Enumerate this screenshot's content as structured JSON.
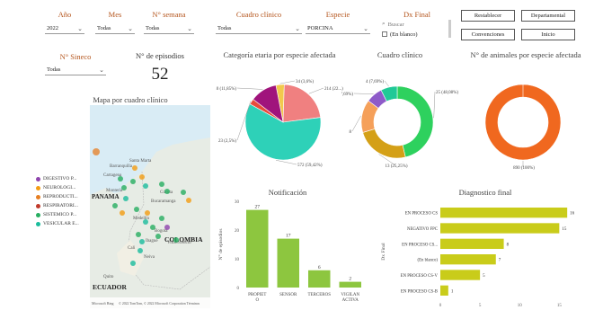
{
  "filters": {
    "ano": {
      "label": "Año",
      "value": "2022"
    },
    "mes": {
      "label": "Mes",
      "value": "Todas"
    },
    "semana": {
      "label": "N° semana",
      "value": "Todas"
    },
    "cuadro": {
      "label": "Cuadro clínico",
      "value": "Todas"
    },
    "especie": {
      "label": "Especie",
      "value": "PORCINA"
    },
    "dx": {
      "label": "Dx Final",
      "search_placeholder": "Buscar",
      "option": "(En blanco)"
    },
    "sineco": {
      "label": "N° Sineco",
      "value": "Todas"
    }
  },
  "buttons": {
    "restablecer": "Restablecer",
    "departamental": "Departamental",
    "convenciones": "Convenciones",
    "inicio": "Inicio"
  },
  "kpi": {
    "label": "N° de episodios",
    "value": "52"
  },
  "map": {
    "title": "Mapa por cuadro clínico",
    "legend": [
      {
        "label": "DIGESTIVO P...",
        "color": "#8e44ad"
      },
      {
        "label": "NEUROLOGI...",
        "color": "#f39c12"
      },
      {
        "label": "REPRODUCTI...",
        "color": "#e67e22"
      },
      {
        "label": "RESPIRATORI...",
        "color": "#c0392b"
      },
      {
        "label": "SISTEMICO P...",
        "color": "#27ae60"
      },
      {
        "label": "VESICULAR E...",
        "color": "#1abc9c"
      }
    ],
    "places": {
      "panama": "PANAMA",
      "colombia": "COLOMBIA",
      "ecuador": "ECUADOR",
      "santa_marta": "Santa Marta",
      "barranquilla": "Barranquilla",
      "cartagena": "Cartagena",
      "monteria": "Montería",
      "medellin": "Medellín",
      "bogota": "Bogotá",
      "cali": "Cali",
      "quito": "Quito",
      "ibague": "Ibagué",
      "villavicencio": "Villavicencio",
      "neiva": "Neiva",
      "cucuta": "Cúcuta",
      "bucaramanga": "Bucaramanga"
    },
    "attribution": "© 2022 TomTom, © 2022 Microsoft Corporation  Términos",
    "bing": "Microsoft Bing"
  },
  "chart_data": [
    {
      "type": "pie",
      "title": "Categoría etaria por especie afectada",
      "slices": [
        {
          "label": "34 (3,6%)",
          "value": 34,
          "color": "#f2c94c"
        },
        {
          "label": "214 (22...)",
          "value": 214,
          "color": "#f08080"
        },
        {
          "label": "572 (59,42%)",
          "value": 572,
          "color": "#2ed1b8"
        },
        {
          "label": "23 (2,5%)",
          "value": 23,
          "color": "#e74c3c"
        },
        {
          "label": "110 (11,85%)",
          "value": 110,
          "color": "#a0147c"
        }
      ]
    },
    {
      "type": "donut",
      "title": "Cuadro clínico",
      "slices": [
        {
          "label": "25 (48,08%)",
          "value": 25,
          "color": "#2ed15e"
        },
        {
          "label": "13 (25,25%)",
          "value": 13,
          "color": "#d4a017"
        },
        {
          "label": "8",
          "value": 8,
          "color": "#f5a05a"
        },
        {
          "label": "4 (7,69%)",
          "value": 4,
          "color": "#8e5bc9"
        },
        {
          "label": "4 (7,69%)",
          "value": 4,
          "color": "#20c997"
        }
      ]
    },
    {
      "type": "donut",
      "title": "N° de animales por especie afectada",
      "slices": [
        {
          "label": "890 (100%)",
          "value": 890,
          "color": "#f0681f"
        }
      ]
    },
    {
      "type": "bar",
      "title": "Notificación",
      "ylabel": "N° de episodios",
      "categories": [
        "PROPIET O",
        "SENSOR",
        "TERCEROS",
        "VIGILAN ACTIVA"
      ],
      "values": [
        27,
        17,
        6,
        2
      ],
      "yticks": [
        0,
        10,
        20,
        30
      ],
      "ylim": [
        0,
        30
      ]
    },
    {
      "type": "bar",
      "title": "Diagnostico final",
      "ylabel": "Dx Final",
      "categories": [
        "EN PROCESO CS",
        "NEGATIVO FPC",
        "EN PROCESO CS...",
        "(En blanco)",
        "EN PROCESO CS-V",
        "EN PROCESO CS-B"
      ],
      "values": [
        16,
        15,
        8,
        7,
        5,
        1
      ],
      "xticks": [
        0,
        5,
        10,
        15
      ],
      "xlim": [
        0,
        17
      ]
    }
  ]
}
